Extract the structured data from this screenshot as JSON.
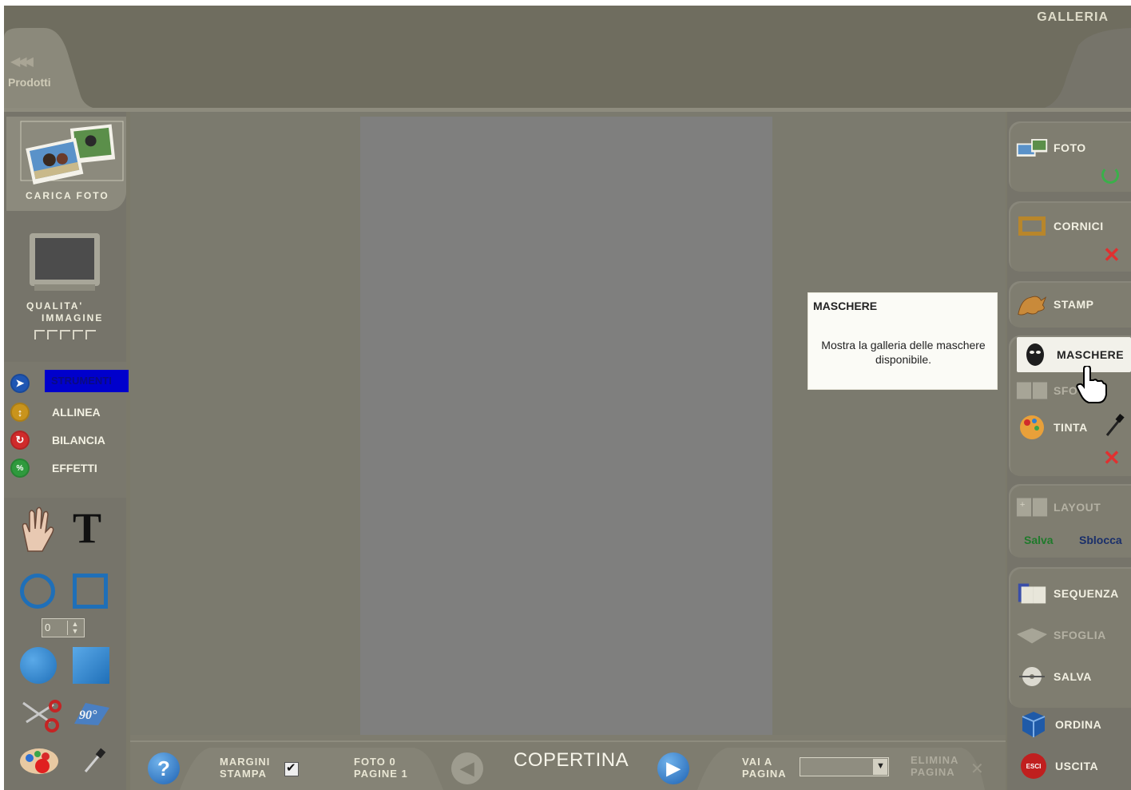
{
  "header": {
    "gallery_title": "GALLERIA",
    "back_label": "Prodotti"
  },
  "left_panel": {
    "upload_label": "CARICA FOTO",
    "quality_label_line1": "QUALITA'",
    "quality_label_line2": "IMMAGINE",
    "menu": [
      {
        "label": "STRUMENTI",
        "color": "#1f56b3",
        "selected": true
      },
      {
        "label": "ALLINEA",
        "color": "#c9941c"
      },
      {
        "label": "BILANCIA",
        "color": "#d02b2b"
      },
      {
        "label": "EFFETTI",
        "color": "#2f9a3d"
      }
    ],
    "border_width_value": "0"
  },
  "right_panel": {
    "foto_label": "FOTO",
    "cornici_label": "CORNICI",
    "stamp_label": "STAMP",
    "maschere_label": "MASCHERE",
    "sfondi_label": "SFO",
    "tinta_label": "TINTA",
    "layout_label": "LAYOUT",
    "salva_link": "Salva",
    "sblocca_link": "Sblocca",
    "sequenza_label": "SEQUENZA",
    "sfoglia_label": "SFOGLIA",
    "salva_label": "SALVA",
    "ordina_label": "ORDINA",
    "uscita_label": "USCITA",
    "esci_badge": "ESCI"
  },
  "tooltip": {
    "title": "MASCHERE",
    "body": "Mostra la galleria delle maschere disponibile."
  },
  "bottom_bar": {
    "help": "?",
    "margini_line1": "MARGINI",
    "margini_line2": "STAMPA",
    "foto_line": "FOTO 0",
    "pagine_line": "PAGINE 1",
    "page_name": "COPERTINA",
    "vai_line1": "VAI A",
    "vai_line2": "PAGINA",
    "elimina_line1": "ELIMINA",
    "elimina_line2": "PAGINA"
  }
}
